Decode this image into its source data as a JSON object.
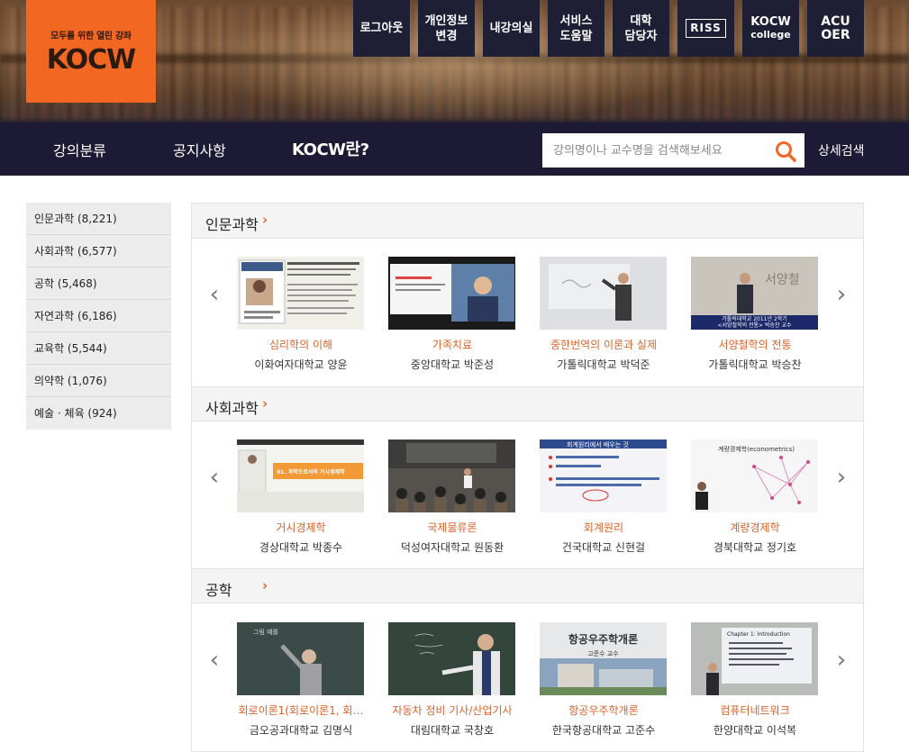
{
  "header": {
    "logo_slogan": "모두를 위한 열린 강좌",
    "logo_text": "KOCW",
    "top_buttons": [
      {
        "label": "로그아웃",
        "icon": ""
      },
      {
        "label": "개인정보\n변경",
        "icon": ""
      },
      {
        "label": "내강의실",
        "icon": ""
      },
      {
        "label": "서비스\n도움말",
        "icon": ""
      },
      {
        "label": "대학\n담당자",
        "icon": ""
      },
      {
        "label": "RISS",
        "icon": "riss-logo"
      },
      {
        "label": "KOCW college",
        "icon": "kocw-college-logo"
      },
      {
        "label": "ACU\nOER",
        "icon": ""
      }
    ],
    "nav": {
      "item1": "강의분류",
      "item2": "공지사항",
      "item3": "KOCW란?"
    },
    "search": {
      "placeholder": "강의명이나 교수명을 검색해보세요",
      "value": "",
      "icon": "search-icon",
      "icon_color": "#f26722"
    },
    "advanced_search": "상세검색",
    "brand_color": "#f26722",
    "button_bg": "#1e1e35"
  },
  "sidebar": {
    "items": [
      {
        "label": "인문과학 (8,221)"
      },
      {
        "label": "사회과학 (6,577)"
      },
      {
        "label": "공학 (5,468)"
      },
      {
        "label": "자연과학 (6,186)"
      },
      {
        "label": "교육학 (5,544)"
      },
      {
        "label": "의약학 (1,076)"
      },
      {
        "label": "예술 · 체육 (924)"
      }
    ]
  },
  "sections": [
    {
      "title": "인문과학",
      "courses": [
        {
          "title": "심리학의 이해",
          "school": "이화여자대학교 양윤"
        },
        {
          "title": "가족치료",
          "school": "중앙대학교 박준성"
        },
        {
          "title": "중한번역의 이론과 실제",
          "school": "가톨릭대학교 박덕준"
        },
        {
          "title": "서양철학의 전통",
          "school": "가톨릭대학교 박승찬"
        }
      ]
    },
    {
      "title": "사회과학",
      "courses": [
        {
          "title": "거시경제학",
          "school": "경상대학교 박종수"
        },
        {
          "title": "국제물류론",
          "school": "덕성여자대학교 원동환"
        },
        {
          "title": "회계원리",
          "school": "건국대학교 신현걸"
        },
        {
          "title": "계량경제학",
          "school": "경북대학교 정기호"
        }
      ]
    },
    {
      "title": "공학",
      "courses": [
        {
          "title": "회로이론1(회로이론1, 회…",
          "school": "금오공과대학교 김명식"
        },
        {
          "title": "자동차 정비 기사/산업기사",
          "school": "대림대학교 국창호"
        },
        {
          "title": "항공우주학개론",
          "school": "한국항공대학교 고준수"
        },
        {
          "title": "컴퓨터네트워크",
          "school": "한양대학교 이석복"
        }
      ]
    }
  ],
  "thumb_text": {
    "t4_caption": "가톨릭대학교 2011년 2학기",
    "t4_caption2": "<서양철학의 전통> 박승찬 교수",
    "t5_banner": "01. 과학으로서의 거시경제학",
    "t7_header": "회계원리에서 배우는 것",
    "t8_title": "계량경제학(econometrics)",
    "t11_title": "항공우주학개론",
    "t11_sub": "고준수 교수",
    "t12_title": "Chapter 1: Introduction",
    "t9_board": "그림 예를"
  }
}
